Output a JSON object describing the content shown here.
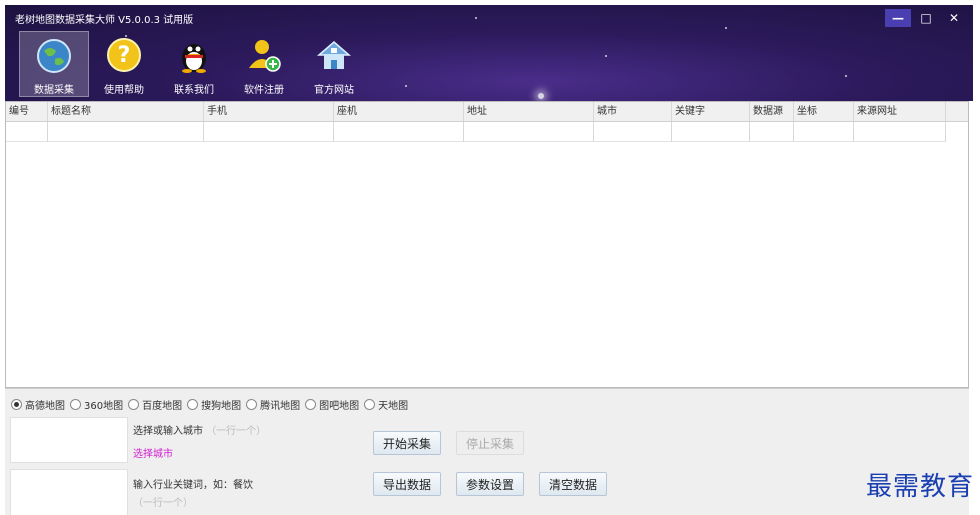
{
  "window": {
    "title": "老树地图数据采集大师 V5.0.0.3 试用版",
    "min": "—",
    "max": "□",
    "close": "✕"
  },
  "toolbar": [
    {
      "label": "数据采集"
    },
    {
      "label": "使用帮助"
    },
    {
      "label": "联系我们"
    },
    {
      "label": "软件注册"
    },
    {
      "label": "官方网站"
    }
  ],
  "table": {
    "headers": [
      "编号",
      "标题名称",
      "手机",
      "座机",
      "地址",
      "城市",
      "关键字",
      "数据源",
      "坐标",
      "来源网址"
    ]
  },
  "maps": {
    "selected": "高德地图",
    "options": [
      "高德地图",
      "360地图",
      "百度地图",
      "搜狗地图",
      "腾讯地图",
      "图吧地图",
      "天地图"
    ]
  },
  "city": {
    "label": "选择或输入城市",
    "placeholder": "（一行一个）",
    "select_link": "选择城市"
  },
  "keyword": {
    "label": "输入行业关键词，如：餐饮",
    "placeholder": "（一行一个）"
  },
  "buttons": {
    "start": "开始采集",
    "stop": "停止采集",
    "export": "导出数据",
    "settings": "参数设置",
    "clear": "清空数据"
  },
  "watermark": "最需教育",
  "colors": {
    "header_bg": "#2c1a5c",
    "link": "#d020d0",
    "watermark": "#1a3fb0"
  }
}
